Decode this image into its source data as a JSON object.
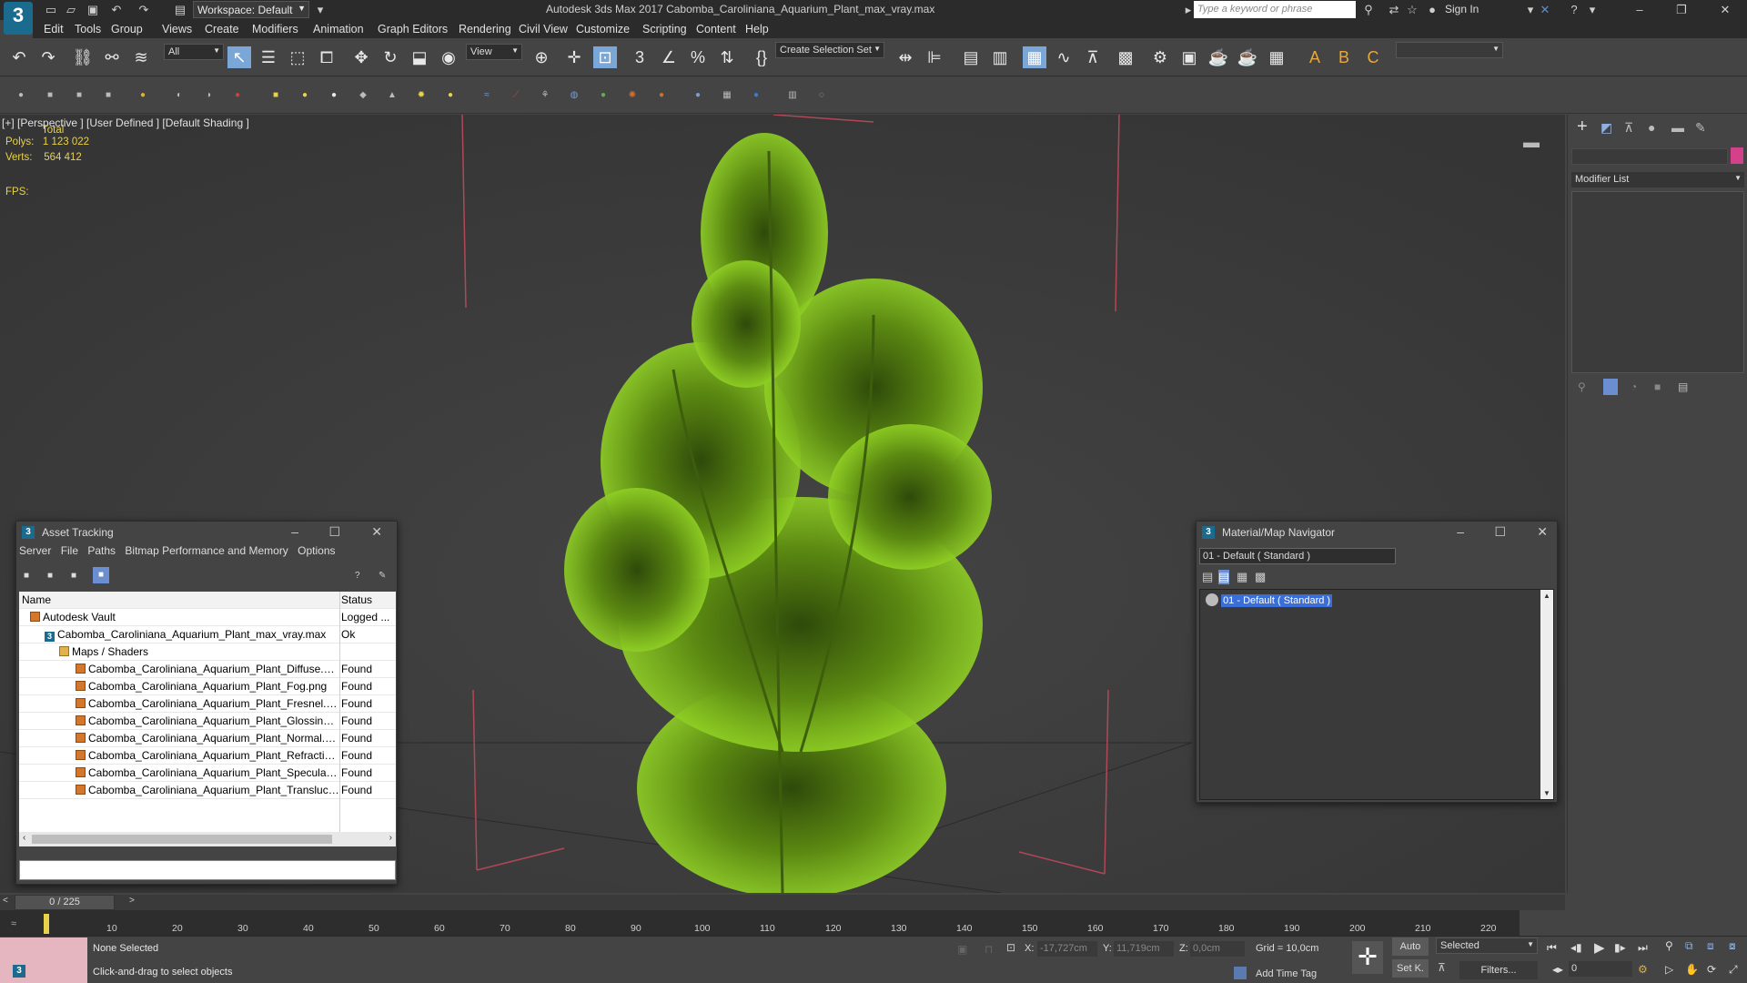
{
  "app": {
    "window_title": "Autodesk 3ds Max 2017     Cabomba_Caroliniana_Aquarium_Plant_max_vray.max",
    "logo_text": "3",
    "logo_caption": "MAX",
    "workspace_label": "Workspace: Default",
    "search_placeholder": "Type a keyword or phrase",
    "sign_in": "Sign In"
  },
  "menu": [
    "Edit",
    "Tools",
    "Group",
    "Views",
    "Create",
    "Modifiers",
    "Animation",
    "Graph Editors",
    "Rendering",
    "Civil View",
    "Customize",
    "Scripting",
    "Content",
    "Help"
  ],
  "toolbar": {
    "filter_value": "All",
    "coord_value": "View",
    "selection_set": "Create Selection Set",
    "letters": [
      "A",
      "B",
      "C"
    ]
  },
  "viewport": {
    "label": "[+] [Perspective ]  [User Defined ]  [Default Shading ]",
    "stats_header": "Total",
    "polys_label": "Polys:",
    "polys_value": "1 123 022",
    "verts_label": "Verts:",
    "verts_value": "564 412",
    "fps_label": "FPS:"
  },
  "command_panel": {
    "modifier_list": "Modifier List",
    "swatch_color": "#d2418a"
  },
  "asset_tracking": {
    "title": "Asset Tracking",
    "menu": [
      "Server",
      "File",
      "Paths",
      "Bitmap Performance and Memory",
      "Options"
    ],
    "col_name": "Name",
    "col_status": "Status",
    "rows": [
      {
        "name": "Autodesk Vault",
        "status": "Logged ..."
      },
      {
        "name": "Cabomba_Caroliniana_Aquarium_Plant_max_vray.max",
        "status": "Ok"
      },
      {
        "name": "Maps / Shaders",
        "status": ""
      },
      {
        "name": "Cabomba_Caroliniana_Aquarium_Plant_Diffuse.png",
        "status": "Found"
      },
      {
        "name": "Cabomba_Caroliniana_Aquarium_Plant_Fog.png",
        "status": "Found"
      },
      {
        "name": "Cabomba_Caroliniana_Aquarium_Plant_Fresnel.png",
        "status": "Found"
      },
      {
        "name": "Cabomba_Caroliniana_Aquarium_Plant_Glossiness...",
        "status": "Found"
      },
      {
        "name": "Cabomba_Caroliniana_Aquarium_Plant_Normal.png",
        "status": "Found"
      },
      {
        "name": "Cabomba_Caroliniana_Aquarium_Plant_Refraction...",
        "status": "Found"
      },
      {
        "name": "Cabomba_Caroliniana_Aquarium_Plant_Specular.p...",
        "status": "Found"
      },
      {
        "name": "Cabomba_Caroliniana_Aquarium_Plant_Translucen...",
        "status": "Found"
      }
    ]
  },
  "material_navigator": {
    "title": "Material/Map Navigator",
    "field_value": "01 - Default  ( Standard )",
    "item": "01 - Default  ( Standard )"
  },
  "timeline": {
    "slider": "0 / 225",
    "ticks": [
      "10",
      "20",
      "30",
      "40",
      "50",
      "60",
      "70",
      "80",
      "90",
      "100",
      "110",
      "120",
      "130",
      "140",
      "150",
      "160",
      "170",
      "180",
      "190",
      "200",
      "210",
      "220"
    ]
  },
  "status": {
    "selection": "None Selected",
    "prompt": "Click-and-drag to select objects",
    "x_label": "X:",
    "x_value": "-17,727cm",
    "y_label": "Y:",
    "y_value": "11,719cm",
    "z_label": "Z:",
    "z_value": "0,0cm",
    "grid": "Grid = 10,0cm",
    "add_time_tag": "Add Time Tag",
    "auto": "Auto",
    "selected": "Selected",
    "set_k": "Set K.",
    "filters": "Filters...",
    "frame": "0"
  }
}
